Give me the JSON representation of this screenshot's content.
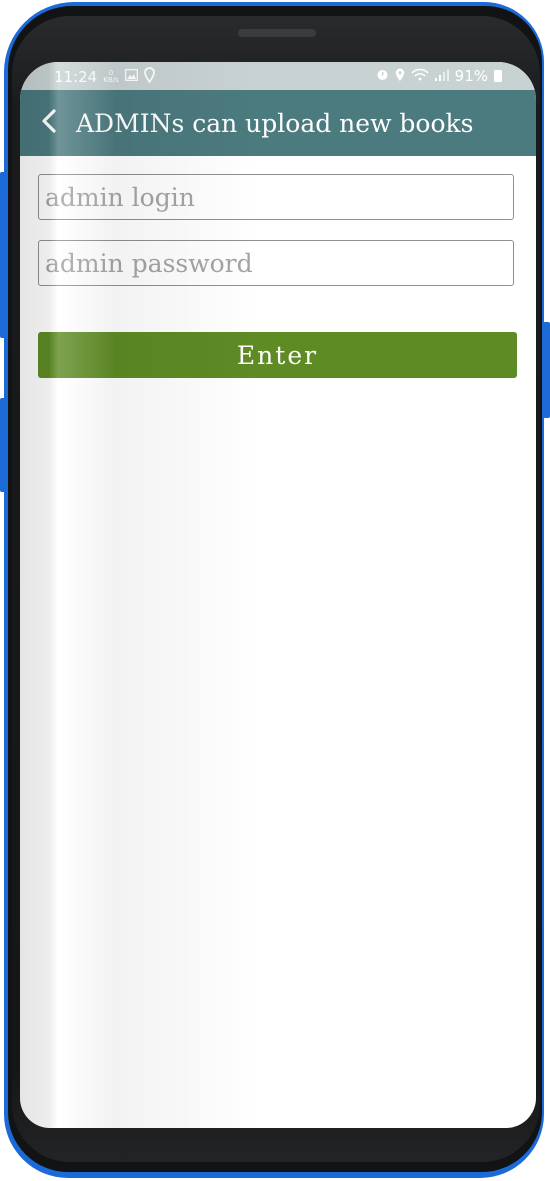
{
  "status_bar": {
    "time": "11:24",
    "net_speed_value": "0",
    "net_speed_unit": "KB/s",
    "battery": "91%"
  },
  "app_bar": {
    "title": "ADMINs can upload new books"
  },
  "form": {
    "login_placeholder": "admin login",
    "login_value": "",
    "password_placeholder": "admin password",
    "password_value": "",
    "enter_label": "Enter"
  },
  "colors": {
    "app_bar": "#4b7a7f",
    "enter_button": "#5e8b24",
    "phone_frame_accent": "#1c6ad8"
  }
}
